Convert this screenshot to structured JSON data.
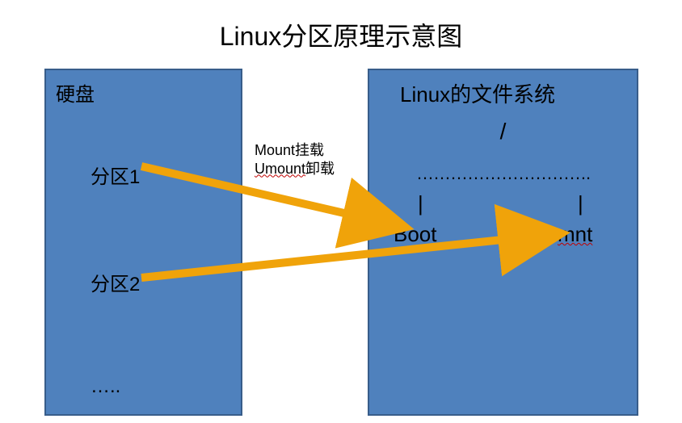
{
  "title": "Linux分区原理示意图",
  "left_panel": {
    "title": "硬盘",
    "partition1": "分区1",
    "partition2": "分区2",
    "ellipsis": "….."
  },
  "right_panel": {
    "title": "Linux的文件系统",
    "root": "/",
    "dots": "………………………….",
    "pipe": "|",
    "boot": "Boot",
    "mnt": "mnt"
  },
  "annotations": {
    "mount": "Mount挂载",
    "umount_u": "Umount",
    "umount_suffix": "卸载"
  },
  "arrows": {
    "arrow1": {
      "from": "分区1",
      "to": "Boot"
    },
    "arrow2": {
      "from": "分区2",
      "to": "mnt"
    }
  },
  "colors": {
    "panel_fill": "#4f81bd",
    "panel_border": "#385d8a",
    "arrow": "#f0a30a"
  }
}
